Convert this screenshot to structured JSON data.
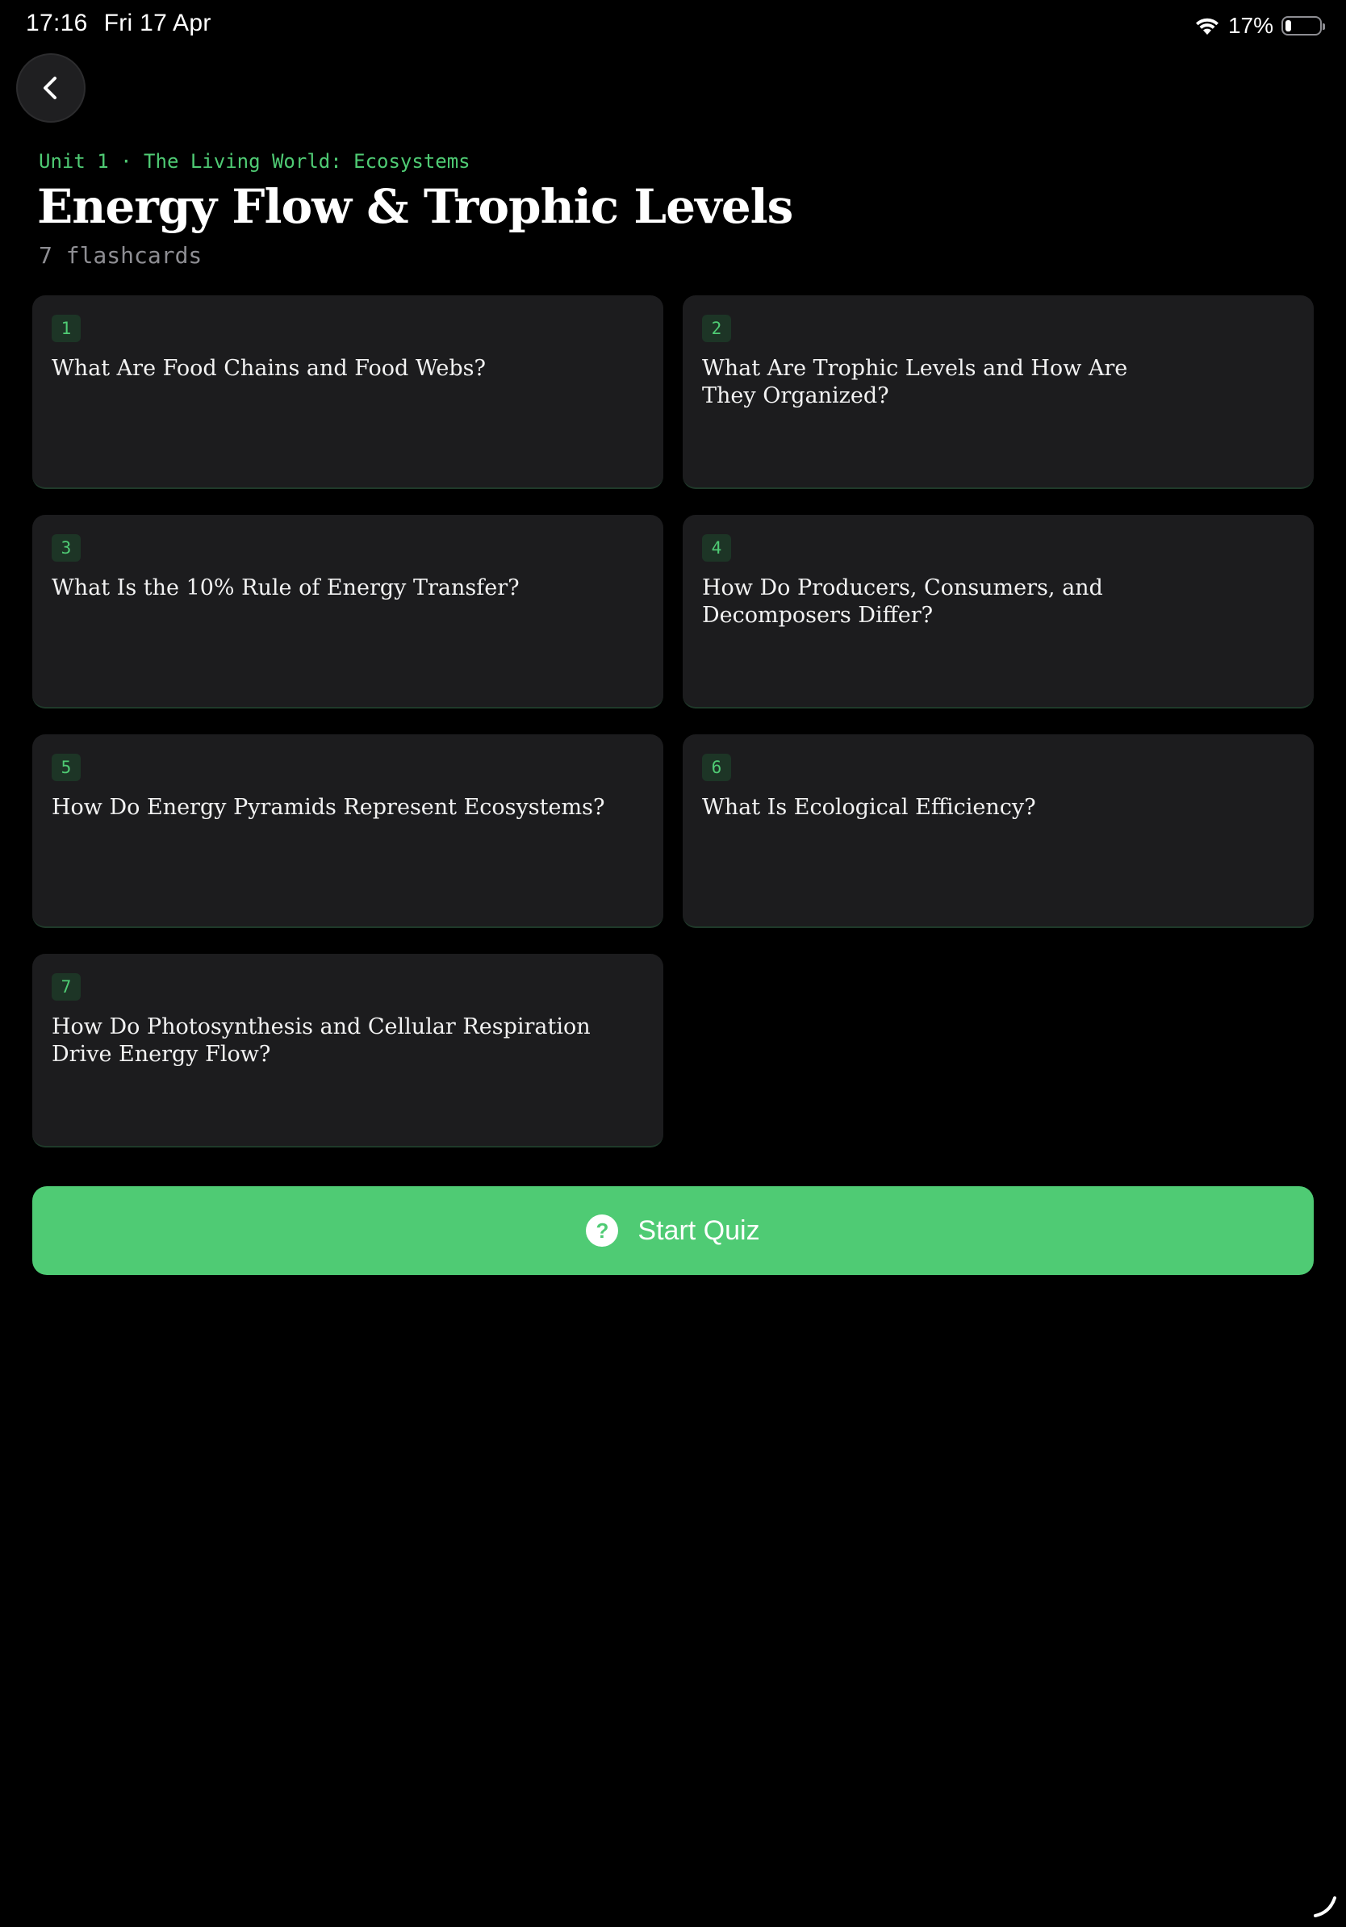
{
  "status_bar": {
    "time": "17:16",
    "date": "Fri 17 Apr",
    "battery_text": "17%",
    "battery_level": 0.17,
    "icons": [
      "wifi-icon",
      "battery-icon"
    ]
  },
  "nav": {
    "back_icon": "chevron-left-icon"
  },
  "header": {
    "unit_label": "Unit 1 · The Living World: Ecosystems",
    "title": "Energy Flow & Trophic Levels",
    "count_label": "7 flashcards"
  },
  "cards": [
    {
      "number": "1",
      "title": "What Are Food Chains and Food Webs?"
    },
    {
      "number": "2",
      "title": "What Are Trophic Levels and How Are They Organized?"
    },
    {
      "number": "3",
      "title": "What Is the 10% Rule of Energy Transfer?"
    },
    {
      "number": "4",
      "title": "How Do Producers, Consumers, and Decomposers Differ?"
    },
    {
      "number": "5",
      "title": "How Do Energy Pyramids Represent Ecosystems?"
    },
    {
      "number": "6",
      "title": "What Is Ecological Efficiency?"
    },
    {
      "number": "7",
      "title": "How Do Photosynthesis and Cellular Respiration Drive Energy Flow?"
    }
  ],
  "quiz": {
    "label": "Start Quiz",
    "icon": "question-circle-icon",
    "icon_glyph": "?"
  },
  "colors": {
    "accent": "#4fcb74",
    "background": "#000000",
    "card": "#1c1c1e"
  }
}
